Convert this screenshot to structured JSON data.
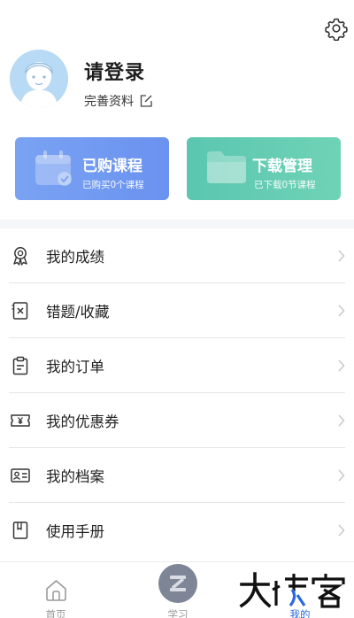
{
  "header": {
    "settings_icon": "gear-icon"
  },
  "profile": {
    "title": "请登录",
    "edit_link": "完善资料",
    "avatar_icon": "user-avatar-icon"
  },
  "cards": {
    "purchased": {
      "title": "已购课程",
      "subtitle": "已购买0个课程",
      "icon": "calendar-icon"
    },
    "download": {
      "title": "下载管理",
      "subtitle": "已下载0节课程",
      "icon": "folder-icon"
    }
  },
  "menu": {
    "items": [
      {
        "label": "我的成绩",
        "icon": "medal-icon"
      },
      {
        "label": "错题/收藏",
        "icon": "error-book-icon"
      },
      {
        "label": "我的订单",
        "icon": "clipboard-icon"
      },
      {
        "label": "我的优惠券",
        "icon": "coupon-icon"
      },
      {
        "label": "我的档案",
        "icon": "id-card-icon"
      },
      {
        "label": "使用手册",
        "icon": "manual-icon"
      }
    ]
  },
  "tabbar": {
    "home": "首页",
    "study": "学习",
    "mine": "我的"
  },
  "watermark": {
    "text": "大 | 客"
  },
  "colors": {
    "purchased_card": "#6f98f1",
    "download_card": "#62cbb3",
    "active_tab": "#2a67e0"
  }
}
